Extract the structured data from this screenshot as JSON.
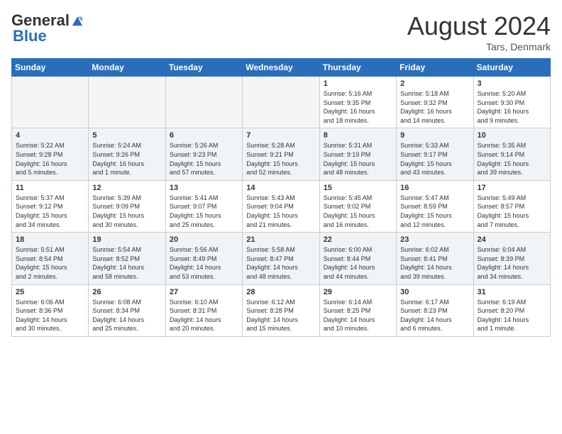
{
  "header": {
    "logo_general": "General",
    "logo_blue": "Blue",
    "month_year": "August 2024",
    "location": "Tars, Denmark"
  },
  "weekdays": [
    "Sunday",
    "Monday",
    "Tuesday",
    "Wednesday",
    "Thursday",
    "Friday",
    "Saturday"
  ],
  "weeks": [
    [
      {
        "day": "",
        "info": ""
      },
      {
        "day": "",
        "info": ""
      },
      {
        "day": "",
        "info": ""
      },
      {
        "day": "",
        "info": ""
      },
      {
        "day": "1",
        "info": "Sunrise: 5:16 AM\nSunset: 9:35 PM\nDaylight: 16 hours\nand 18 minutes."
      },
      {
        "day": "2",
        "info": "Sunrise: 5:18 AM\nSunset: 9:32 PM\nDaylight: 16 hours\nand 14 minutes."
      },
      {
        "day": "3",
        "info": "Sunrise: 5:20 AM\nSunset: 9:30 PM\nDaylight: 16 hours\nand 9 minutes."
      }
    ],
    [
      {
        "day": "4",
        "info": "Sunrise: 5:22 AM\nSunset: 9:28 PM\nDaylight: 16 hours\nand 5 minutes."
      },
      {
        "day": "5",
        "info": "Sunrise: 5:24 AM\nSunset: 9:26 PM\nDaylight: 16 hours\nand 1 minute."
      },
      {
        "day": "6",
        "info": "Sunrise: 5:26 AM\nSunset: 9:23 PM\nDaylight: 15 hours\nand 57 minutes."
      },
      {
        "day": "7",
        "info": "Sunrise: 5:28 AM\nSunset: 9:21 PM\nDaylight: 15 hours\nand 52 minutes."
      },
      {
        "day": "8",
        "info": "Sunrise: 5:31 AM\nSunset: 9:19 PM\nDaylight: 15 hours\nand 48 minutes."
      },
      {
        "day": "9",
        "info": "Sunrise: 5:33 AM\nSunset: 9:17 PM\nDaylight: 15 hours\nand 43 minutes."
      },
      {
        "day": "10",
        "info": "Sunrise: 5:35 AM\nSunset: 9:14 PM\nDaylight: 15 hours\nand 39 minutes."
      }
    ],
    [
      {
        "day": "11",
        "info": "Sunrise: 5:37 AM\nSunset: 9:12 PM\nDaylight: 15 hours\nand 34 minutes."
      },
      {
        "day": "12",
        "info": "Sunrise: 5:39 AM\nSunset: 9:09 PM\nDaylight: 15 hours\nand 30 minutes."
      },
      {
        "day": "13",
        "info": "Sunrise: 5:41 AM\nSunset: 9:07 PM\nDaylight: 15 hours\nand 25 minutes."
      },
      {
        "day": "14",
        "info": "Sunrise: 5:43 AM\nSunset: 9:04 PM\nDaylight: 15 hours\nand 21 minutes."
      },
      {
        "day": "15",
        "info": "Sunrise: 5:45 AM\nSunset: 9:02 PM\nDaylight: 15 hours\nand 16 minutes."
      },
      {
        "day": "16",
        "info": "Sunrise: 5:47 AM\nSunset: 8:59 PM\nDaylight: 15 hours\nand 12 minutes."
      },
      {
        "day": "17",
        "info": "Sunrise: 5:49 AM\nSunset: 8:57 PM\nDaylight: 15 hours\nand 7 minutes."
      }
    ],
    [
      {
        "day": "18",
        "info": "Sunrise: 5:51 AM\nSunset: 8:54 PM\nDaylight: 15 hours\nand 2 minutes."
      },
      {
        "day": "19",
        "info": "Sunrise: 5:54 AM\nSunset: 8:52 PM\nDaylight: 14 hours\nand 58 minutes."
      },
      {
        "day": "20",
        "info": "Sunrise: 5:56 AM\nSunset: 8:49 PM\nDaylight: 14 hours\nand 53 minutes."
      },
      {
        "day": "21",
        "info": "Sunrise: 5:58 AM\nSunset: 8:47 PM\nDaylight: 14 hours\nand 48 minutes."
      },
      {
        "day": "22",
        "info": "Sunrise: 6:00 AM\nSunset: 8:44 PM\nDaylight: 14 hours\nand 44 minutes."
      },
      {
        "day": "23",
        "info": "Sunrise: 6:02 AM\nSunset: 8:41 PM\nDaylight: 14 hours\nand 39 minutes."
      },
      {
        "day": "24",
        "info": "Sunrise: 6:04 AM\nSunset: 8:39 PM\nDaylight: 14 hours\nand 34 minutes."
      }
    ],
    [
      {
        "day": "25",
        "info": "Sunrise: 6:06 AM\nSunset: 8:36 PM\nDaylight: 14 hours\nand 30 minutes."
      },
      {
        "day": "26",
        "info": "Sunrise: 6:08 AM\nSunset: 8:34 PM\nDaylight: 14 hours\nand 25 minutes."
      },
      {
        "day": "27",
        "info": "Sunrise: 6:10 AM\nSunset: 8:31 PM\nDaylight: 14 hours\nand 20 minutes."
      },
      {
        "day": "28",
        "info": "Sunrise: 6:12 AM\nSunset: 8:28 PM\nDaylight: 14 hours\nand 15 minutes."
      },
      {
        "day": "29",
        "info": "Sunrise: 6:14 AM\nSunset: 8:25 PM\nDaylight: 14 hours\nand 10 minutes."
      },
      {
        "day": "30",
        "info": "Sunrise: 6:17 AM\nSunset: 8:23 PM\nDaylight: 14 hours\nand 6 minutes."
      },
      {
        "day": "31",
        "info": "Sunrise: 6:19 AM\nSunset: 8:20 PM\nDaylight: 14 hours\nand 1 minute."
      }
    ]
  ]
}
